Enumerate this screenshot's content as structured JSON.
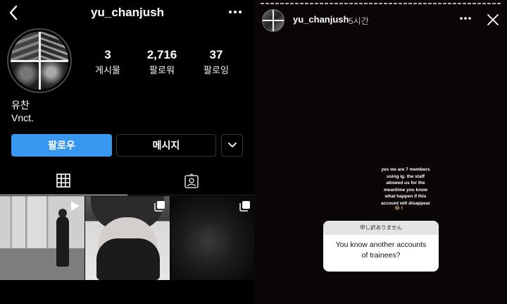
{
  "profile": {
    "username": "yu_chanjush",
    "stats": [
      {
        "value": "3",
        "label": "게시물"
      },
      {
        "value": "2,716",
        "label": "팔로워"
      },
      {
        "value": "37",
        "label": "팔로잉"
      }
    ],
    "name": "유찬",
    "bio": "Vnct.",
    "follow_label": "팔로우",
    "message_label": "메시지",
    "accent_color": "#3897f0",
    "icons": [
      "back-icon",
      "more-icon",
      "chevron-down-icon",
      "grid-icon",
      "tagged-icon",
      "video-icon",
      "multi-post-icon"
    ]
  },
  "story": {
    "username": "yu_chanjush",
    "time": "5시간",
    "text_lines": [
      "yes we are 7 members",
      "using ig. the staff",
      "allowed us for the",
      "meantime you know",
      "what happen if this",
      "account will disappear"
    ],
    "emoji": "😂✌",
    "question_header": "申し訳ありません",
    "question_lines": [
      "You know another accounts",
      "of trainees?"
    ],
    "icons": [
      "more-icon",
      "close-icon"
    ]
  }
}
